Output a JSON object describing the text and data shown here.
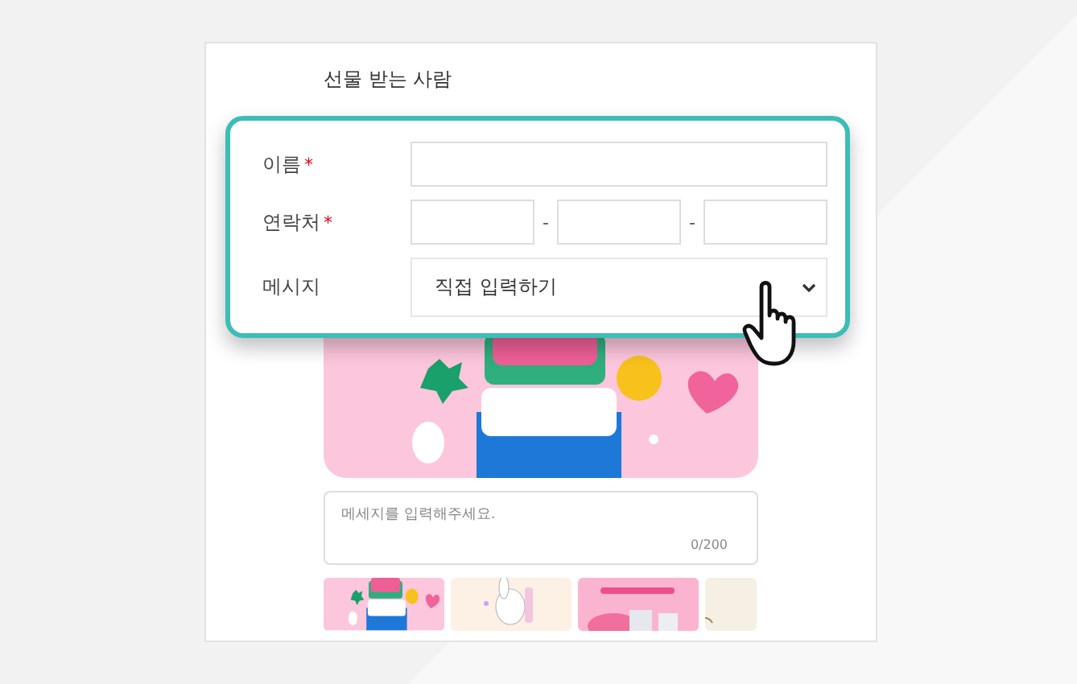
{
  "section_title": "선물 받는 사람",
  "required_mark": "*",
  "form": [
    {
      "kind": "text",
      "label": "이름",
      "required": true
    },
    {
      "kind": "phone",
      "label": "연락처",
      "required": true,
      "separators": [
        "-",
        "-"
      ]
    },
    {
      "kind": "select",
      "label": "메시지",
      "required": false,
      "value": "직접 입력하기"
    }
  ],
  "message_box": {
    "placeholder": "메세지를 입력해주세요.",
    "counter": "0/200"
  }
}
